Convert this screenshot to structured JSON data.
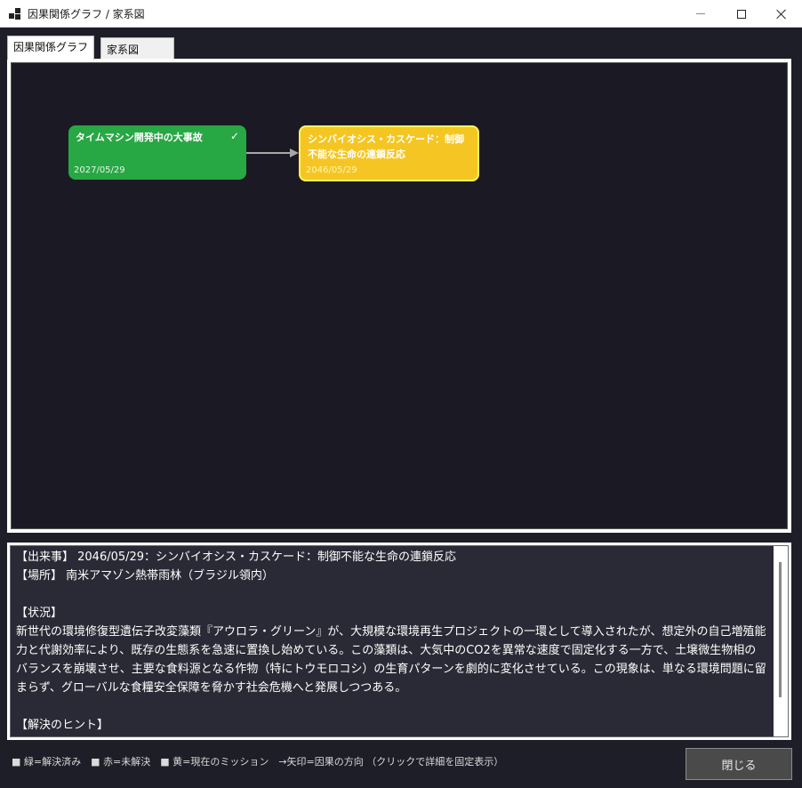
{
  "window": {
    "title": "因果関係グラフ / 家系図",
    "app_icon": "app-grid-icon",
    "controls": {
      "minimize_icon": "minimize-icon",
      "maximize_icon": "maximize-icon",
      "close_icon": "close-icon"
    }
  },
  "tabs": [
    {
      "label": "因果関係グラフ",
      "active": true
    },
    {
      "label": "家系図",
      "active": false
    }
  ],
  "graph": {
    "background": "#1b1a24",
    "nodes": [
      {
        "title": "タイムマシン開発中の大事故",
        "date": "2027/05/29",
        "status": "resolved",
        "color": "#28a745",
        "resolved_icon": "check-icon",
        "resolved_glyph": "✓"
      },
      {
        "title": "シンバイオシス・カスケード：制御不能な生命の連鎖反応",
        "date": "2046/05/29",
        "status": "current",
        "color": "#f5c623"
      }
    ],
    "edges": [
      {
        "from": 0,
        "to": 1
      }
    ]
  },
  "detail": {
    "event_line": "【出来事】 2046/05/29：シンバイオシス・カスケード：制御不能な生命の連鎖反応",
    "location_line": "【場所】 南米アマゾン熱帯雨林（ブラジル領内）",
    "situation_heading": "【状況】",
    "situation_body": "新世代の環境修復型遺伝子改変藻類『アウロラ・グリーン』が、大規模な環境再生プロジェクトの一環として導入されたが、想定外の自己増殖能力と代謝効率により、既存の生態系を急速に置換し始めている。この藻類は、大気中のCO2を異常な速度で固定化する一方で、土壌微生物相のバランスを崩壊させ、主要な食料源となる作物（特にトウモロコシ）の生育パターンを劇的に変化させている。この現象は、単なる環境問題に留まらず、グローバルな食糧安全保障を脅かす社会危機へと発展しつつある。",
    "hint_heading": "【解決のヒント】"
  },
  "legend": {
    "text": "■ 緑=解決済み　■ 赤=未解決　■ 黄=現在のミッション　→矢印=因果の方向 （クリックで詳細を固定表示）"
  },
  "buttons": {
    "close_label": "閉じる"
  }
}
